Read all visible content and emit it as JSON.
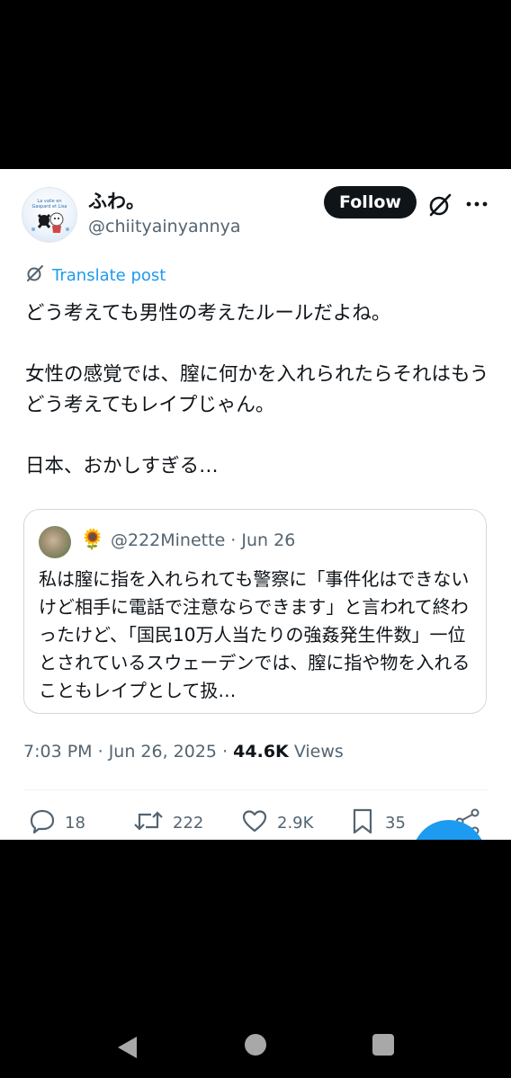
{
  "author": {
    "display_name": "ふわ。",
    "handle": "@chiityainyannya"
  },
  "buttons": {
    "follow_label": "Follow"
  },
  "icons": {
    "grok": "grok-icon",
    "more": "more-icon",
    "translate": "translate-icon"
  },
  "translate": {
    "label": "Translate post"
  },
  "tweet": {
    "text": "どう考えても男性の考えたルールだよね。\n\n女性の感覚では、膣に何かを入れられたらそれはもうどう考えてもレイプじゃん。\n\n日本、おかしすぎる…"
  },
  "quote": {
    "emoji": "🌻",
    "handle": "@222Minette",
    "separator": " · ",
    "date": "Jun 26",
    "text": "私は膣に指を入れられても警察に「事件化はできないけど相手に電話で注意ならできます」と言われて終わったけど、「国民10万人当たりの強姦発生件数」一位とされているスウェーデンでは、膣に指や物を入れることもレイプとして扱…"
  },
  "meta": {
    "time": "7:03 PM",
    "sep": " · ",
    "date": "Jun 26, 2025",
    "views_count": "44.6K",
    "views_label": "Views"
  },
  "actions": {
    "replies": "18",
    "reposts": "222",
    "likes": "2.9K",
    "bookmarks": "35"
  },
  "colors": {
    "accent": "#1d9bf0",
    "text_primary": "#0f1419",
    "text_secondary": "#536471",
    "background": "#ffffff",
    "outer": "#000000"
  }
}
